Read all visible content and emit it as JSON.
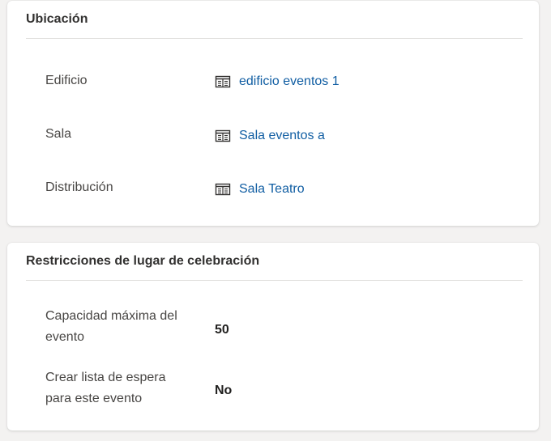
{
  "ubicacion": {
    "title": "Ubicación",
    "fields": [
      {
        "label": "Edificio",
        "value": "edificio eventos 1",
        "icon": "building-record-icon"
      },
      {
        "label": "Sala",
        "value": "Sala eventos a",
        "icon": "building-record-icon"
      },
      {
        "label": "Distribución",
        "value": "Sala Teatro",
        "icon": "building-record-icon"
      }
    ]
  },
  "restricciones": {
    "title": "Restricciones de lugar de celebración",
    "fields": [
      {
        "label_line1": "Capacidad máxima del",
        "label_line2": "evento",
        "value": "50"
      },
      {
        "label_line1": "Crear lista de espera",
        "label_line2": "para este evento",
        "value": "No"
      }
    ]
  },
  "colors": {
    "link": "#115ea3",
    "label": "#484644",
    "divider": "#e1dfdd",
    "background": "#f3f2f1"
  }
}
